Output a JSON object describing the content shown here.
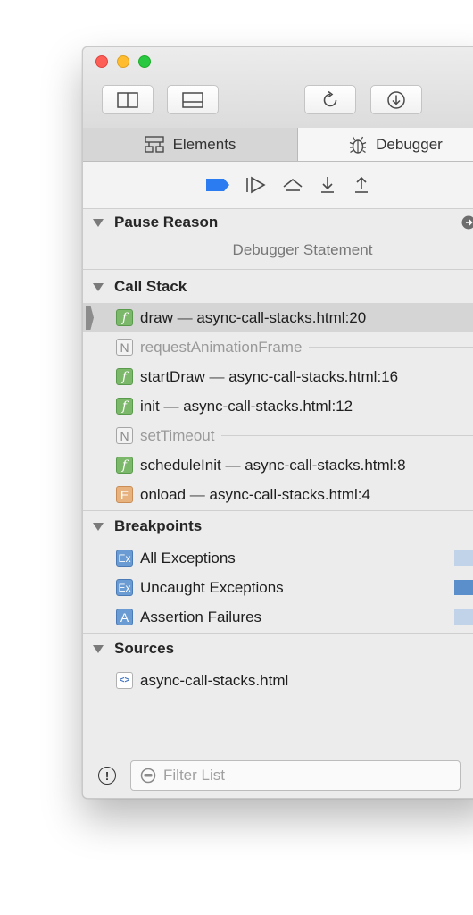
{
  "tabs": {
    "elements": "Elements",
    "debugger": "Debugger"
  },
  "pause_reason": {
    "title": "Pause Reason",
    "text": "Debugger Statement"
  },
  "call_stack": {
    "title": "Call Stack",
    "frames": [
      {
        "type": "f",
        "name": "draw",
        "sep": " — ",
        "location": "async-call-stacks.html:20",
        "selected": true
      },
      {
        "type": "n",
        "name": "requestAnimationFrame",
        "boundary": true
      },
      {
        "type": "f",
        "name": "startDraw",
        "sep": " — ",
        "location": "async-call-stacks.html:16"
      },
      {
        "type": "f",
        "name": "init",
        "sep": " — ",
        "location": "async-call-stacks.html:12"
      },
      {
        "type": "n",
        "name": "setTimeout",
        "boundary": true
      },
      {
        "type": "f",
        "name": "scheduleInit",
        "sep": " — ",
        "location": "async-call-stacks.html:8"
      },
      {
        "type": "e",
        "name": "onload",
        "sep": " — ",
        "location": "async-call-stacks.html:4"
      }
    ],
    "badge_letters": {
      "f": "f",
      "n": "N",
      "e": "E"
    }
  },
  "breakpoints": {
    "title": "Breakpoints",
    "items": [
      {
        "badge": "Ex",
        "label": "All Exceptions",
        "enabled": false
      },
      {
        "badge": "Ex",
        "label": "Uncaught Exceptions",
        "enabled": true
      },
      {
        "badge": "A",
        "label": "Assertion Failures",
        "enabled": false
      }
    ]
  },
  "sources": {
    "title": "Sources",
    "items": [
      {
        "badge": "<>",
        "label": "async-call-stacks.html"
      }
    ]
  },
  "filter": {
    "placeholder": "Filter List"
  },
  "colors": {
    "accent": "#2b7cf0",
    "breakpoint_on": "#5b8fcc",
    "breakpoint_off": "#c0d3e8"
  }
}
